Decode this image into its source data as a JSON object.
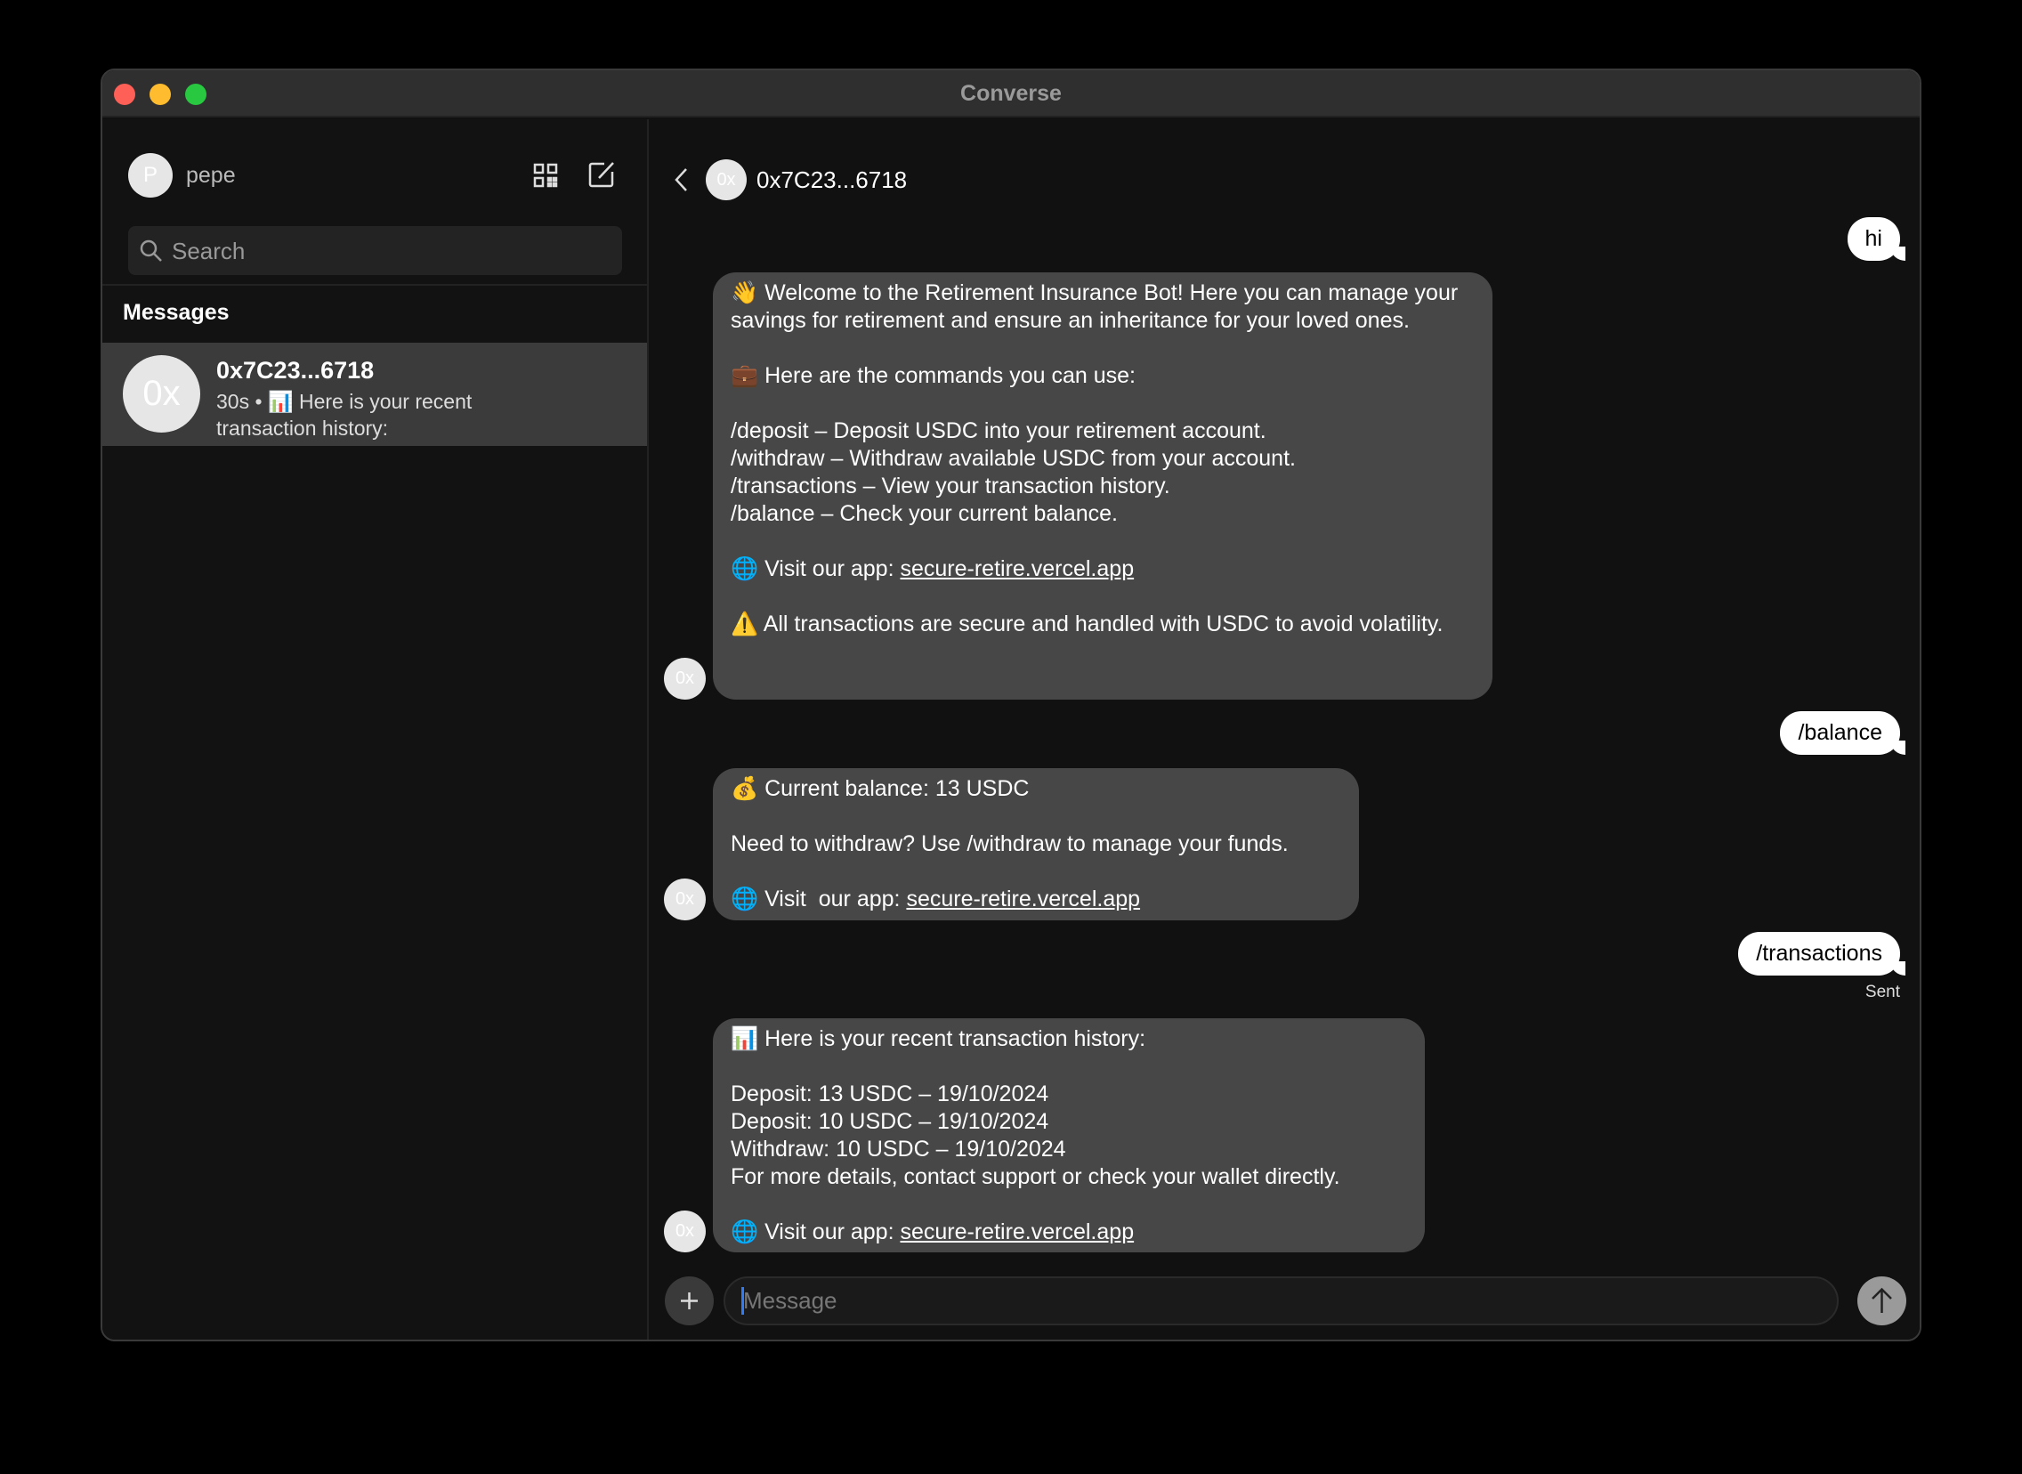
{
  "window": {
    "title": "Converse"
  },
  "sidebar": {
    "user": {
      "initial": "P",
      "name": "pepe"
    },
    "search_placeholder": "Search",
    "section_title": "Messages",
    "conversations": [
      {
        "avatar": "0x",
        "name": "0x7C23...6718",
        "time": "30s",
        "separator": "•",
        "preview_emoji": "📊",
        "preview": "Here is your recent transaction history:"
      }
    ]
  },
  "chat": {
    "header": {
      "avatar": "0x",
      "name": "0x7C23...6718"
    },
    "messages": [
      {
        "from": "me",
        "text": "hi"
      },
      {
        "from": "bot",
        "avatar": "0x",
        "lines": [
          "👋 Welcome to the Retirement Insurance Bot! Here you can manage your savings for retirement and ensure an inheritance for your loved ones.",
          "",
          "💼 Here are the commands you can use:",
          "",
          "/deposit – Deposit USDC into your retirement account.",
          "/withdraw – Withdraw available USDC from your account.",
          "/transactions – View your transaction history.",
          "/balance – Check your current balance.",
          ""
        ],
        "link_prefix": "🌐 Visit our app: ",
        "link": "secure-retire.vercel.app",
        "footer": "⚠️ All transactions are secure and handled with USDC to avoid volatility."
      },
      {
        "from": "me",
        "text": "/balance"
      },
      {
        "from": "bot",
        "avatar": "0x",
        "lines": [
          "💰 Current balance: 13 USDC",
          "",
          "Need to withdraw? Use /withdraw to manage your funds.",
          ""
        ],
        "link_prefix": "🌐 Visit  our app: ",
        "link": "secure-retire.vercel.app"
      },
      {
        "from": "me",
        "text": "/transactions",
        "status": "Sent"
      },
      {
        "from": "bot",
        "avatar": "0x",
        "lines": [
          "📊 Here is your recent transaction history:",
          "",
          "Deposit: 13 USDC – 19/10/2024",
          "Deposit: 10 USDC – 19/10/2024",
          "Withdraw: 10 USDC – 19/10/2024",
          "For more details, contact support or check your wallet directly.",
          ""
        ],
        "link_prefix": "🌐 Visit our app: ",
        "link": "secure-retire.vercel.app"
      }
    ],
    "composer": {
      "placeholder": "Message",
      "value": ""
    }
  },
  "colors": {
    "close": "#fe5f57",
    "minimize": "#febc2e",
    "zoom": "#28c840",
    "bubble_bot": "#474747",
    "bubble_me": "#ffffff"
  }
}
